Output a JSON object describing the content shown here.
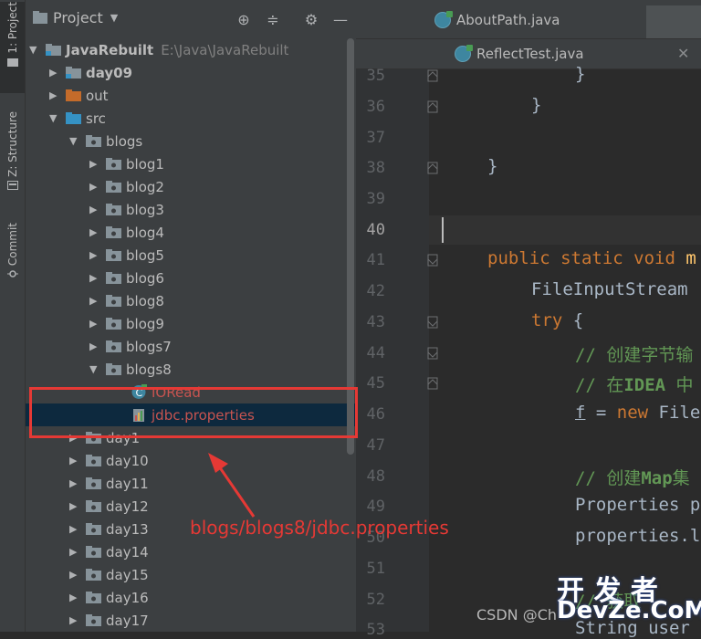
{
  "stripe": {
    "tabs": [
      {
        "label": "1: Project"
      },
      {
        "label": "Z: Structure"
      },
      {
        "label": "Commit"
      }
    ]
  },
  "panel": {
    "title": "Project",
    "tree": [
      {
        "label": "JavaRebuilt",
        "path": "E:\\Java\\JavaRebuilt"
      },
      {
        "label": "day09"
      },
      {
        "label": "out"
      },
      {
        "label": "src"
      },
      {
        "label": "blogs"
      },
      {
        "label": "blog1"
      },
      {
        "label": "blog2"
      },
      {
        "label": "blog3"
      },
      {
        "label": "blog4"
      },
      {
        "label": "blog5"
      },
      {
        "label": "blog6"
      },
      {
        "label": "blog8"
      },
      {
        "label": "blog9"
      },
      {
        "label": "blogs7"
      },
      {
        "label": "blogs8"
      },
      {
        "label": "IORead"
      },
      {
        "label": "jdbc.properties"
      },
      {
        "label": "day1"
      },
      {
        "label": "day10"
      },
      {
        "label": "day11"
      },
      {
        "label": "day12"
      },
      {
        "label": "day13"
      },
      {
        "label": "day14"
      },
      {
        "label": "day15"
      },
      {
        "label": "day16"
      },
      {
        "label": "day17"
      }
    ]
  },
  "editor": {
    "tabs": [
      {
        "label": "AboutPath.java"
      },
      {
        "label": "ReflectTest.java"
      }
    ],
    "line_numbers": [
      "35",
      "36",
      "37",
      "38",
      "39",
      "40",
      "41",
      "42",
      "43",
      "44",
      "45",
      "46",
      "47",
      "48",
      "49",
      "50",
      "51",
      "52",
      "53"
    ],
    "code": {
      "l35": "}",
      "l36": "}",
      "l38": "}",
      "l41_kw": "public static void ",
      "l41_fn": "m",
      "l42": "FileInputStream ",
      "l43_kw": "try",
      "l43_rest": " {",
      "l44": "// 创建字节输",
      "l45_a": "// 在",
      "l45_b": "IDEA",
      "l45_c": " 中",
      "l46_f": "f",
      "l46_eq": " = ",
      "l46_new": "new",
      "l46_rest": " File",
      "l48_a": "// 创建",
      "l48_b": "Map",
      "l48_c": "集",
      "l49": "Properties p",
      "l50": "properties.l",
      "l52": "// 获取",
      "l53": "String user"
    }
  },
  "annotation": {
    "text": "blogs/blogs8/jdbc.properties"
  },
  "watermark": {
    "csdn": "CSDN @Ch",
    "logo_top": "开 发 者",
    "logo_bottom": "DevZe.CoM"
  },
  "colors": {
    "panel_bg": "#3c3f41",
    "editor_bg": "#2b2b2b",
    "selection": "#0d293e",
    "keyword": "#cc7832",
    "comment": "#629755",
    "annotation": "#e53935"
  }
}
